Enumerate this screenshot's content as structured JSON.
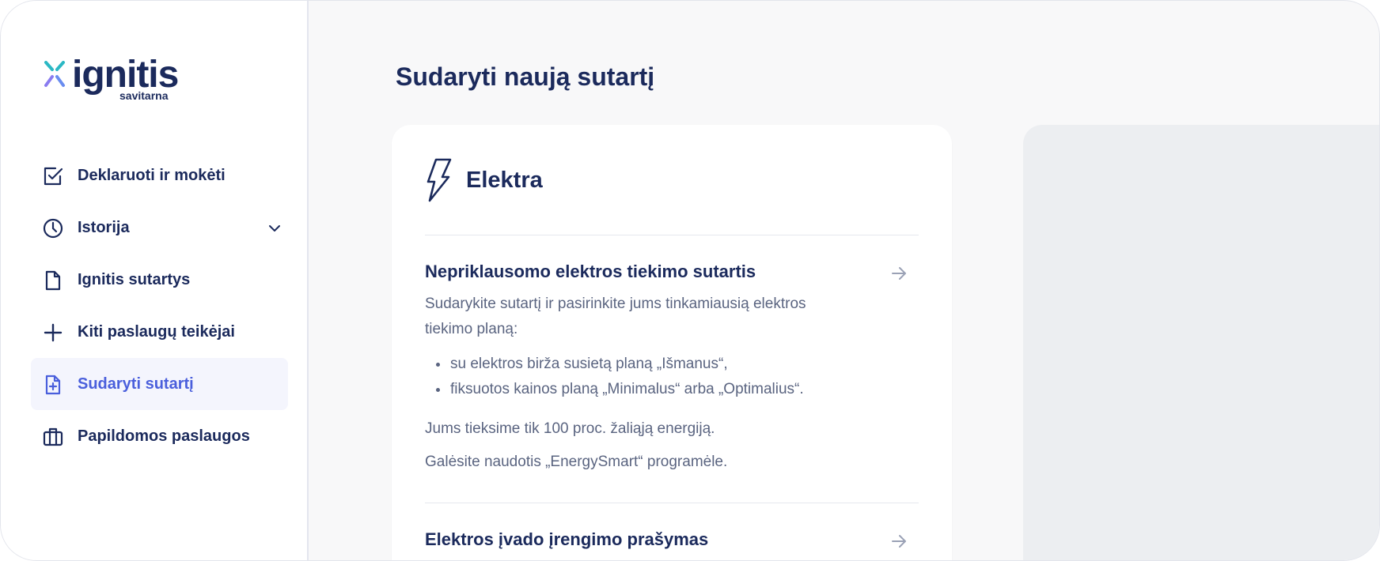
{
  "brand": {
    "name": "ignitis",
    "subtitle": "savitarna",
    "colors": {
      "navy": "#1b2a5c",
      "accent": "#4a5fdc",
      "logo_teal": "#2bb8c4",
      "logo_violet": "#8a7cf0"
    }
  },
  "sidebar": {
    "items": [
      {
        "label": "Deklaruoti ir mokėti",
        "icon": "checkbox-icon",
        "active": false
      },
      {
        "label": "Istorija",
        "icon": "clock-icon",
        "active": false,
        "expandable": true
      },
      {
        "label": "Ignitis sutartys",
        "icon": "document-icon",
        "active": false
      },
      {
        "label": "Kiti paslaugų teikėjai",
        "icon": "plus-icon",
        "active": false
      },
      {
        "label": "Sudaryti sutartį",
        "icon": "document-plus-icon",
        "active": true
      },
      {
        "label": "Papildomos paslaugos",
        "icon": "briefcase-icon",
        "active": false
      }
    ]
  },
  "main": {
    "title": "Sudaryti naują sutartį",
    "card": {
      "title": "Elektra",
      "icon": "lightning-icon",
      "offers": [
        {
          "title": "Nepriklausomo elektros tiekimo sutartis",
          "intro": "Sudarykite sutartį ir pasirinkite jums tinkamiausią elektros tiekimo planą:",
          "bullets": [
            "su elektros birža susietą planą „Išmanus“,",
            "fiksuotos kainos planą „Minimalus“ arba „Optimalius“."
          ],
          "notes": [
            "Jums tieksime tik 100 proc. žaliąją energiją.",
            "Galėsite naudotis „EnergySmart“ programėle."
          ]
        },
        {
          "title": "Elektros įvado įrengimo prašymas"
        }
      ]
    }
  }
}
